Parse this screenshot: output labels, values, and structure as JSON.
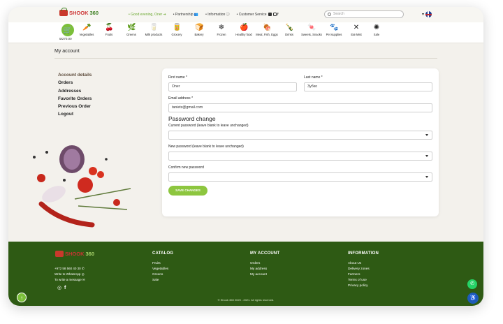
{
  "brand": {
    "name_red": "SHOOK",
    "name_green": "360"
  },
  "topbar": {
    "greeting": "Good evening, Oner",
    "links": [
      "Partnership",
      "Information",
      "Customer Service"
    ],
    "search_placeholder": "Search"
  },
  "cart": {
    "price": "₪270.00"
  },
  "categories": [
    {
      "label": "Vegetables",
      "icon": "carrot-icon"
    },
    {
      "label": "Fruits",
      "icon": "cherry-icon"
    },
    {
      "label": "Greens",
      "icon": "herb-icon"
    },
    {
      "label": "Milk products",
      "icon": "milk-icon"
    },
    {
      "label": "Grocery",
      "icon": "grocery-icon"
    },
    {
      "label": "Bakery",
      "icon": "bread-icon"
    },
    {
      "label": "Frozen",
      "icon": "snowflake-icon"
    },
    {
      "label": "Healthy food",
      "icon": "health-icon"
    },
    {
      "label": "Meat, Fish, Eggs",
      "icon": "meat-icon"
    },
    {
      "label": "Drinks",
      "icon": "bottle-icon"
    },
    {
      "label": "Sweets, Snacks",
      "icon": "candy-icon"
    },
    {
      "label": "Pet supplies",
      "icon": "pet-icon"
    },
    {
      "label": "Eat-Mist",
      "icon": "utensils-icon"
    },
    {
      "label": "Sale",
      "icon": "sale-icon"
    }
  ],
  "page": {
    "title": "My account"
  },
  "account_menu": [
    "Account details",
    "Orders",
    "Addresses",
    "Favorite Orders",
    "Previous Order",
    "Logout"
  ],
  "form": {
    "first_name_label": "First name *",
    "first_name_value": "Oner",
    "last_name_label": "Last name *",
    "last_name_value": "Зубко",
    "email_label": "Email address *",
    "email_value": "tanietz@gmail.com",
    "password_heading": "Password change",
    "current_password_label": "Current password (leave blank to leave unchanged)",
    "new_password_label": "New password (leave blank to leave unchanged)",
    "confirm_password_label": "Confirm new password",
    "save_label": "SAVE CHANGES"
  },
  "footer": {
    "phone": "+972 58 560 40 30",
    "whatsapp": "Write to WhatsApp",
    "message": "To write a message",
    "catalog_title": "CATALOG",
    "catalog_links": [
      "Fruits",
      "Vegetables",
      "Greens",
      "Sale"
    ],
    "account_title": "MY ACCOUNT",
    "account_links": [
      "Orders",
      "My address",
      "My account"
    ],
    "info_title": "INFORMATION",
    "info_links": [
      "About Us",
      "Delivery zones",
      "Farmers",
      "Terms of use",
      "Privacy policy"
    ],
    "copyright": "© Shook 360 2020 - 2021. All rights reserved."
  },
  "colors": {
    "accent": "#8dc63f",
    "footer": "#2e5a14",
    "brand_red": "#c9392c"
  }
}
